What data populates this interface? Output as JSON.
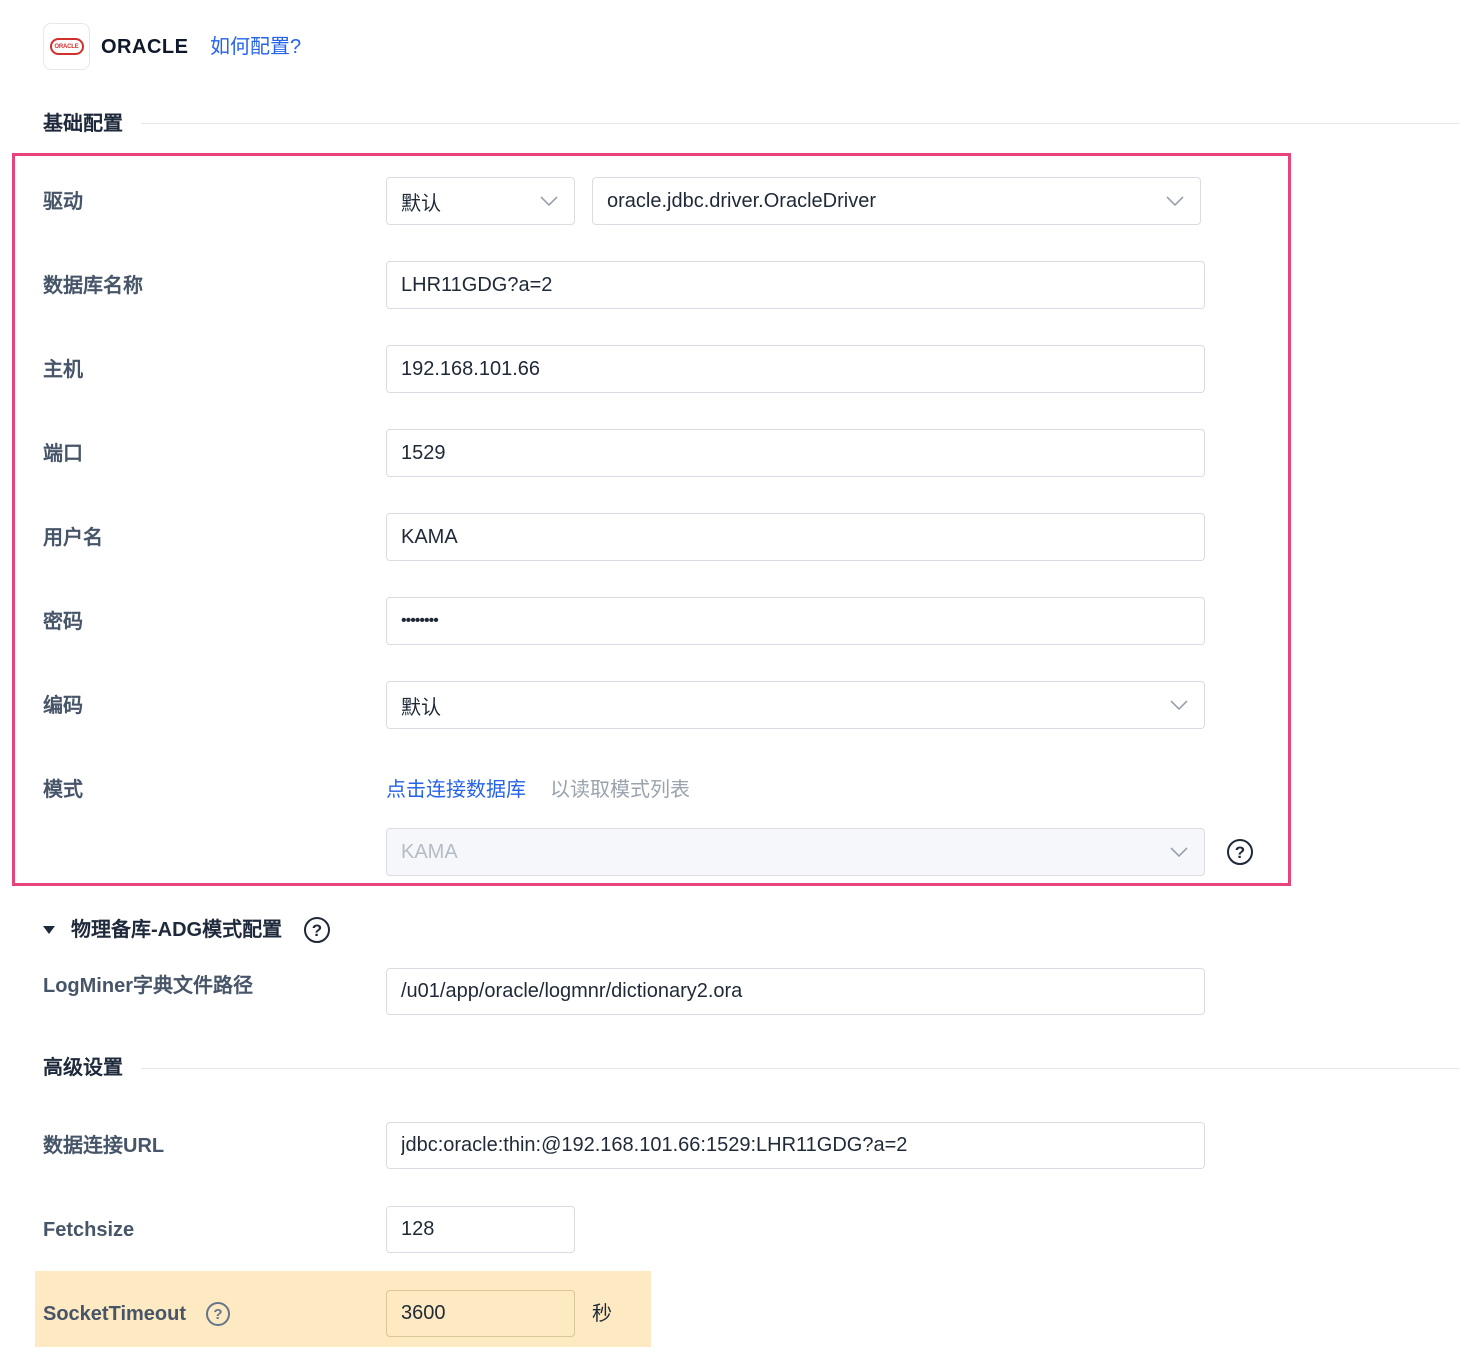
{
  "header": {
    "logo_text": "ORACLE",
    "title": "ORACLE",
    "help_link": "如何配置?"
  },
  "basic": {
    "section_title": "基础配置",
    "driver": {
      "label": "驱动",
      "type_value": "默认",
      "class_value": "oracle.jdbc.driver.OracleDriver"
    },
    "db_name": {
      "label": "数据库名称",
      "value": "LHR11GDG?a=2"
    },
    "host": {
      "label": "主机",
      "value": "192.168.101.66"
    },
    "port": {
      "label": "端口",
      "value": "1529"
    },
    "username": {
      "label": "用户名",
      "value": "KAMA"
    },
    "password": {
      "label": "密码",
      "value": "••••••••"
    },
    "encoding": {
      "label": "编码",
      "value": "默认"
    },
    "schema": {
      "label": "模式",
      "connect_link": "点击连接数据库",
      "hint": "以读取模式列表",
      "value": "KAMA"
    }
  },
  "adg": {
    "section_title": "物理备库-ADG模式配置",
    "logminer": {
      "label": "LogMiner字典文件路径",
      "value": "/u01/app/oracle/logmnr/dictionary2.ora"
    }
  },
  "advanced": {
    "section_title": "高级设置",
    "url": {
      "label": "数据连接URL",
      "value": "jdbc:oracle:thin:@192.168.101.66:1529:LHR11GDG?a=2"
    },
    "fetchsize": {
      "label": "Fetchsize",
      "value": "128"
    },
    "socket_timeout": {
      "label": "SocketTimeout",
      "value": "3600",
      "unit": "秒"
    }
  },
  "colors": {
    "accent": "#2563eb",
    "highlight_border": "#e8437b",
    "highlight_fill": "#feeac2"
  }
}
